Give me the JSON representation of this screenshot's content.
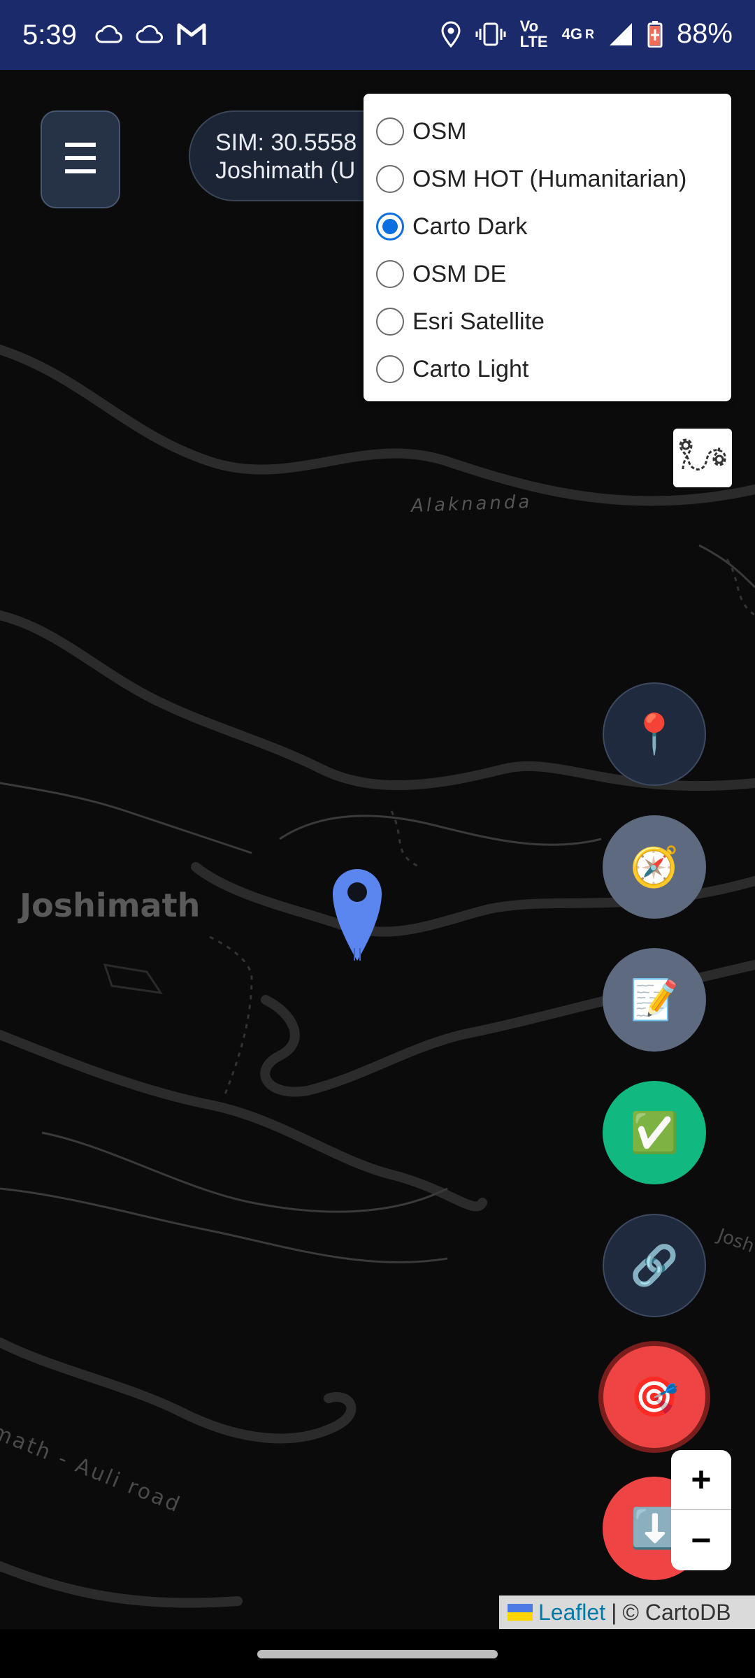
{
  "status_bar": {
    "time": "5:39",
    "network_label": "4G",
    "volte_label": "Vo LTE",
    "roaming_label": "R",
    "battery_percent": "88%",
    "icons": [
      "cloud-icon",
      "cloud-icon",
      "gmail-icon",
      "location-icon",
      "vibrate-icon",
      "signal-icon",
      "battery-icon"
    ]
  },
  "sim_info": {
    "line1": "SIM: 30.5558",
    "line2": "Joshimath (U"
  },
  "menu_button": {
    "label": "☰"
  },
  "layer_control": {
    "options": [
      {
        "label": "OSM",
        "checked": false
      },
      {
        "label": "OSM HOT (Humanitarian)",
        "checked": false
      },
      {
        "label": "Carto Dark",
        "checked": true
      },
      {
        "label": "OSM DE",
        "checked": false
      },
      {
        "label": "Esri Satellite",
        "checked": false
      },
      {
        "label": "Carto Light",
        "checked": false
      }
    ]
  },
  "map_labels": {
    "river": "Alaknanda",
    "town": "Joshimath",
    "road": "math - Auli road",
    "edge": "Josh"
  },
  "fab_buttons": [
    {
      "name": "pin-button",
      "icon": "📍",
      "color": "#1f2a3f"
    },
    {
      "name": "compass-button",
      "icon": "🧭",
      "color": "#5e6a80"
    },
    {
      "name": "notes-button",
      "icon": "📝",
      "color": "#5e6a80"
    },
    {
      "name": "check-button",
      "icon": "✅",
      "color": "#11b981"
    },
    {
      "name": "link-button",
      "icon": "🔗",
      "color": "#1f2a3f"
    },
    {
      "name": "target-button",
      "icon": "🎯",
      "color": "#ef4444"
    },
    {
      "name": "download-button",
      "icon": "⬇️",
      "color": "#ef4444"
    }
  ],
  "zoom": {
    "in_label": "+",
    "out_label": "−"
  },
  "attribution": {
    "leaflet": "Leaflet",
    "separator": "|",
    "provider": "© CartoDB"
  }
}
